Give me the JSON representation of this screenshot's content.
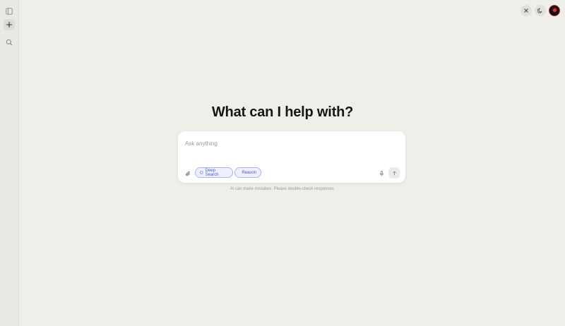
{
  "rail": {
    "sidebar_icon": "sidebar-icon",
    "new_chat_icon": "plus-icon",
    "search_icon": "search-icon"
  },
  "topbar": {
    "close_icon": "close-icon",
    "theme_icon": "moon-icon"
  },
  "main": {
    "headline": "What can I help with?",
    "input": {
      "placeholder": "Ask anything",
      "value": ""
    },
    "chips": [
      {
        "label": "Deep Search",
        "icon": "globe-icon"
      },
      {
        "label": "Reason",
        "icon": "bolt-icon"
      }
    ],
    "attach_icon": "paperclip-icon",
    "mic_icon": "microphone-icon",
    "send_icon": "arrow-up-icon",
    "disclaimer": "AI can make mistakes. Please double-check responses."
  },
  "colors": {
    "background": "#efeee9",
    "accent": "#4b56c8",
    "chip_border": "#a9b3f2"
  }
}
